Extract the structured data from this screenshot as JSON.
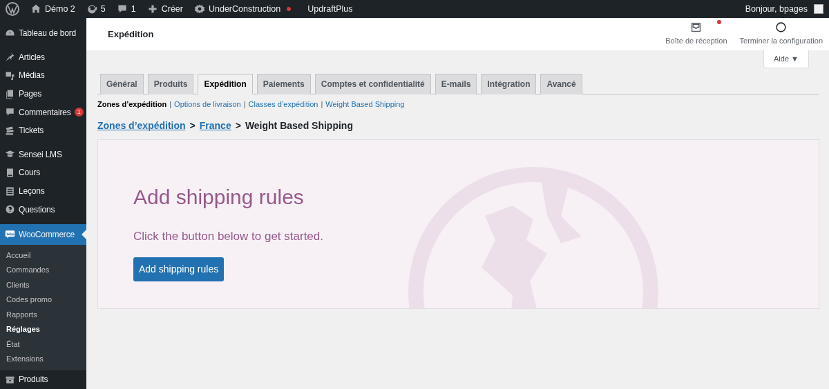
{
  "admin_bar": {
    "items": [
      {
        "kind": "logo"
      },
      {
        "kind": "home",
        "label": "Démo 2"
      },
      {
        "kind": "updates",
        "label": "5"
      },
      {
        "kind": "comments",
        "label": "1"
      },
      {
        "kind": "create",
        "label": "Créer"
      },
      {
        "kind": "gear",
        "label": "UnderConstruction",
        "dot": true
      },
      {
        "kind": "text",
        "label": "UpdraftPlus"
      }
    ],
    "greeting": "Bonjour, bpages"
  },
  "sidebar": {
    "groups": [
      {
        "items": [
          {
            "kind": "dashboard",
            "label": "Tableau de bord",
            "selected": false
          }
        ]
      },
      {
        "items": [
          {
            "kind": "pin",
            "label": "Articles",
            "selected": false
          },
          {
            "kind": "media",
            "label": "Médias",
            "selected": false
          },
          {
            "kind": "pages",
            "label": "Pages",
            "selected": false
          },
          {
            "kind": "comments",
            "label": "Commentaires",
            "badge": "1",
            "selected": false
          },
          {
            "kind": "tickets",
            "label": "Tickets",
            "selected": false
          }
        ]
      },
      {
        "items": [
          {
            "kind": "cap",
            "label": "Sensei LMS",
            "selected": false
          },
          {
            "kind": "book",
            "label": "Cours",
            "selected": false
          },
          {
            "kind": "list",
            "label": "Leçons",
            "selected": false
          },
          {
            "kind": "help",
            "label": "Questions",
            "selected": false
          }
        ]
      },
      {
        "items": [
          {
            "kind": "woo",
            "label": "WooCommerce",
            "selected": true,
            "children": [
              {
                "label": "Accueil",
                "selected": false
              },
              {
                "label": "Commandes",
                "selected": false
              },
              {
                "label": "Clients",
                "selected": false
              },
              {
                "label": "Codes promo",
                "selected": false
              },
              {
                "label": "Rapports",
                "selected": false
              },
              {
                "label": "Réglages",
                "selected": true
              },
              {
                "label": "État",
                "selected": false
              },
              {
                "label": "Extensions",
                "selected": false
              }
            ]
          },
          {
            "kind": "box",
            "label": "Produits",
            "selected": false
          }
        ]
      }
    ]
  },
  "header": {
    "title": "Expédition",
    "actions": [
      {
        "kind": "inbox",
        "label": "Boîte de réception",
        "dot": true
      },
      {
        "kind": "circle",
        "label": "Terminer la configuration",
        "dot": false
      }
    ]
  },
  "help_button": "Aide ▼",
  "tabs": [
    {
      "label": "Général",
      "selected": false
    },
    {
      "label": "Produits",
      "selected": false
    },
    {
      "label": "Expédition",
      "selected": true
    },
    {
      "label": "Paiements",
      "selected": false
    },
    {
      "label": "Comptes et confidentialité",
      "selected": false
    },
    {
      "label": "E-mails",
      "selected": false
    },
    {
      "label": "Intégration",
      "selected": false
    },
    {
      "label": "Avancé",
      "selected": false
    }
  ],
  "subnav_separator": "|",
  "subnav": [
    {
      "label": "Zones d’expédition",
      "selected": true
    },
    {
      "label": "Options de livraison",
      "selected": false
    },
    {
      "label": "Classes d’expédition",
      "selected": false
    },
    {
      "label": "Weight Based Shipping",
      "selected": false
    }
  ],
  "breadcrumb": {
    "links": [
      "Zones d’expédition",
      "France"
    ],
    "separator": ">",
    "current": "Weight Based Shipping"
  },
  "panel": {
    "title": "Add shipping rules",
    "subtitle": "Click the button below to get started.",
    "button": "Add shipping rules"
  }
}
